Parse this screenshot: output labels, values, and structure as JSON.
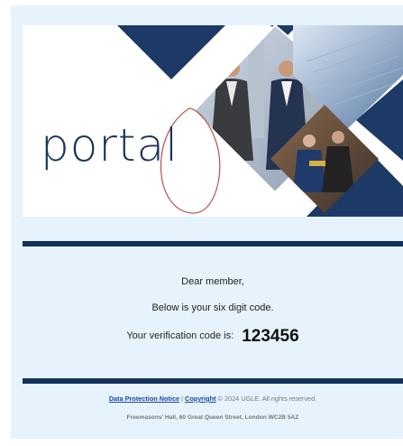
{
  "banner": {
    "logo_text": "portal"
  },
  "message": {
    "greeting": "Dear member,",
    "intro": "Below is your six digit code.",
    "code_label": "Your verification code is:",
    "code": "123456"
  },
  "footer": {
    "data_protection_label": "Data Protection Notice",
    "separator": "|",
    "copyright_label": "Copyright",
    "copyright_text": "© 2024 UGLE. All rights reserved.",
    "address": "Freemasons' Hall, 60 Great Queen Street, London WC2B 5AZ"
  },
  "colors": {
    "navy": "#11315a",
    "background": "#e7f3fc",
    "accent_line": "#b9534a",
    "link": "#1a47a8"
  }
}
